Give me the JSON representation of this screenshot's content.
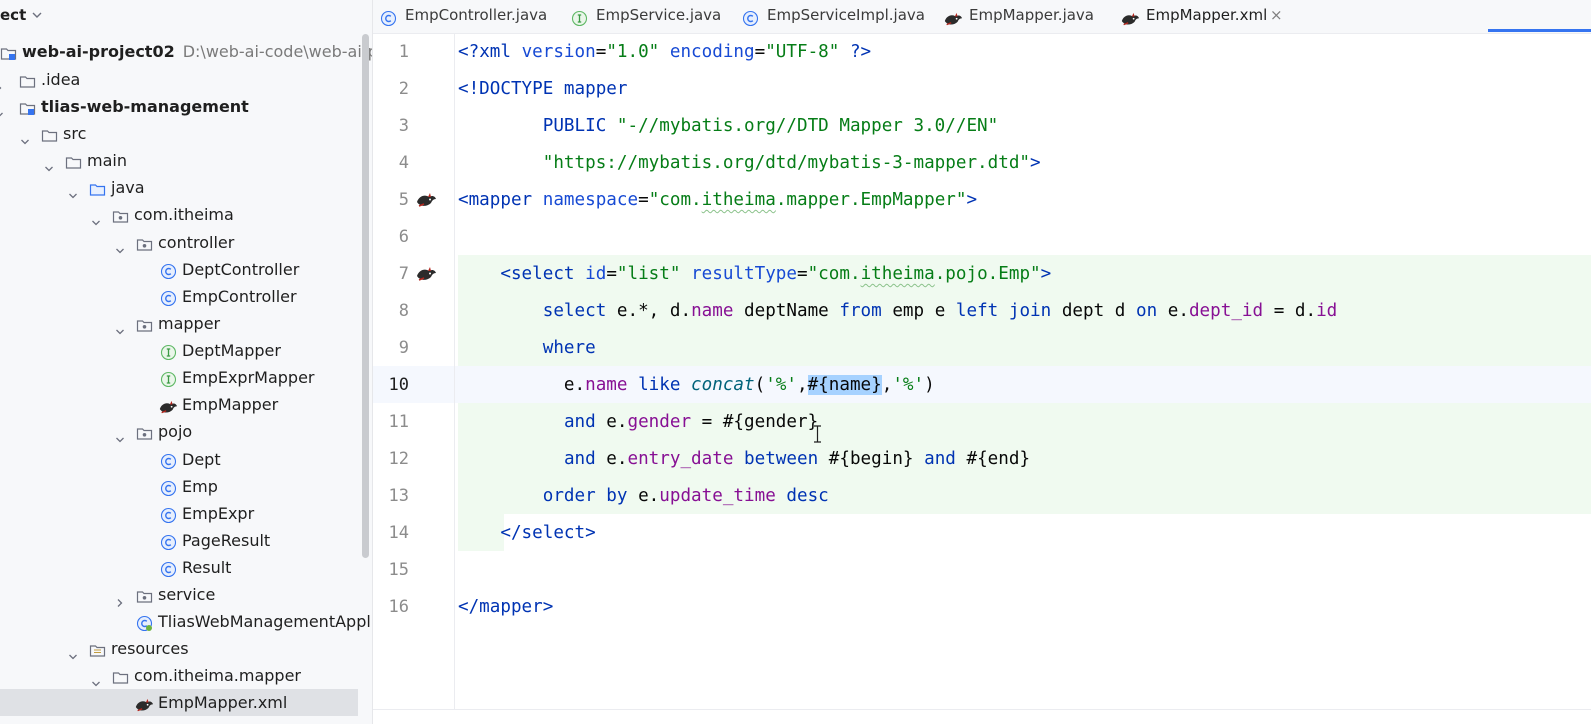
{
  "project_panel": {
    "title": "ect",
    "tree": [
      {
        "label": "web-ai-project02",
        "path": "D:\\web-ai-code\\web-ai-proj",
        "icon": "module-icon",
        "bold": true
      },
      {
        "label": ".idea",
        "icon": "folder-icon"
      },
      {
        "label": "tlias-web-management",
        "icon": "module-icon",
        "bold": true
      },
      {
        "label": "src",
        "icon": "folder-icon"
      },
      {
        "label": "main",
        "icon": "folder-icon"
      },
      {
        "label": "java",
        "icon": "source-folder-icon"
      },
      {
        "label": "com.itheima",
        "icon": "package-icon"
      },
      {
        "label": "controller",
        "icon": "package-icon"
      },
      {
        "label": "DeptController",
        "icon": "class-icon"
      },
      {
        "label": "EmpController",
        "icon": "class-icon"
      },
      {
        "label": "mapper",
        "icon": "package-icon"
      },
      {
        "label": "DeptMapper",
        "icon": "interface-icon"
      },
      {
        "label": "EmpExprMapper",
        "icon": "interface-icon"
      },
      {
        "label": "EmpMapper",
        "icon": "mybatis-icon"
      },
      {
        "label": "pojo",
        "icon": "package-icon"
      },
      {
        "label": "Dept",
        "icon": "class-icon"
      },
      {
        "label": "Emp",
        "icon": "class-icon"
      },
      {
        "label": "EmpExpr",
        "icon": "class-icon"
      },
      {
        "label": "PageResult",
        "icon": "class-icon"
      },
      {
        "label": "Result",
        "icon": "class-icon"
      },
      {
        "label": "service",
        "icon": "package-icon"
      },
      {
        "label": "TliasWebManagementApplic",
        "icon": "spring-app-icon"
      },
      {
        "label": "resources",
        "icon": "resources-folder-icon"
      },
      {
        "label": "com.itheima.mapper",
        "icon": "folder-icon"
      },
      {
        "label": "EmpMapper.xml",
        "icon": "mybatis-icon",
        "selected": true
      }
    ]
  },
  "tabs": [
    {
      "label": "EmpController.java",
      "icon": "class-icon"
    },
    {
      "label": "EmpService.java",
      "icon": "interface-icon"
    },
    {
      "label": "EmpServiceImpl.java",
      "icon": "class-icon"
    },
    {
      "label": "EmpMapper.java",
      "icon": "mybatis-icon"
    },
    {
      "label": "EmpMapper.xml",
      "icon": "mybatis-icon",
      "active": true
    }
  ],
  "tab_close": "×",
  "editor": {
    "current_line": "10",
    "line_numbers": [
      "1",
      "2",
      "3",
      "4",
      "5",
      "6",
      "7",
      "8",
      "9",
      "10",
      "11",
      "12",
      "13",
      "14",
      "15",
      "16"
    ],
    "lines": [
      {
        "n": "1",
        "segs": [
          [
            "pi",
            "<?"
          ],
          [
            "tag",
            "xml "
          ],
          [
            "attr",
            "version"
          ],
          [
            "plain",
            "="
          ],
          [
            "str",
            "\"1.0\""
          ],
          [
            "plain",
            " "
          ],
          [
            "attr",
            "encoding"
          ],
          [
            "plain",
            "="
          ],
          [
            "str",
            "\"UTF-8\""
          ],
          [
            "plain",
            " "
          ],
          [
            "pi",
            "?>"
          ]
        ]
      },
      {
        "n": "2",
        "segs": [
          [
            "tag",
            "<!DOCTYPE mapper"
          ]
        ]
      },
      {
        "n": "3",
        "segs": [
          [
            "plain",
            "        "
          ],
          [
            "tag",
            "PUBLIC "
          ],
          [
            "str",
            "\"-//mybatis.org//DTD Mapper 3.0//EN\""
          ]
        ]
      },
      {
        "n": "4",
        "segs": [
          [
            "plain",
            "        "
          ],
          [
            "str",
            "\"https://mybatis.org/dtd/mybatis-3-mapper.dtd\""
          ],
          [
            "tag",
            ">"
          ]
        ]
      },
      {
        "n": "5",
        "segs": [
          [
            "tag",
            "<mapper "
          ],
          [
            "attr",
            "namespace"
          ],
          [
            "plain",
            "="
          ],
          [
            "str",
            "\"com."
          ],
          [
            "strw",
            "itheima"
          ],
          [
            "str",
            ".mapper.EmpMapper\""
          ],
          [
            "tag",
            ">"
          ]
        ]
      },
      {
        "n": "6",
        "segs": []
      },
      {
        "n": "7",
        "segs": [
          [
            "plain",
            "    "
          ],
          [
            "tag",
            "<select "
          ],
          [
            "attr",
            "id"
          ],
          [
            "plain",
            "="
          ],
          [
            "str",
            "\"list\""
          ],
          [
            "plain",
            " "
          ],
          [
            "attr",
            "resultType"
          ],
          [
            "plain",
            "="
          ],
          [
            "str",
            "\"com."
          ],
          [
            "strw",
            "itheima"
          ],
          [
            "str",
            ".pojo.Emp\""
          ],
          [
            "tag",
            ">"
          ]
        ]
      },
      {
        "n": "8",
        "segs": [
          [
            "plain",
            "        "
          ],
          [
            "kw",
            "select"
          ],
          [
            "plain",
            " e.*, d."
          ],
          [
            "fld",
            "name"
          ],
          [
            "plain",
            " deptName "
          ],
          [
            "kw",
            "from"
          ],
          [
            "plain",
            " emp e "
          ],
          [
            "kw",
            "left join"
          ],
          [
            "plain",
            " dept d "
          ],
          [
            "kw",
            "on"
          ],
          [
            "plain",
            " e."
          ],
          [
            "fld",
            "dept_id"
          ],
          [
            "plain",
            " = d."
          ],
          [
            "fld",
            "id"
          ]
        ]
      },
      {
        "n": "9",
        "segs": [
          [
            "plain",
            "        "
          ],
          [
            "kw",
            "where"
          ]
        ]
      },
      {
        "n": "10",
        "segs": [
          [
            "plain",
            "          e."
          ],
          [
            "fld",
            "name"
          ],
          [
            "plain",
            " "
          ],
          [
            "kw",
            "like"
          ],
          [
            "plain",
            " "
          ],
          [
            "fn",
            "concat"
          ],
          [
            "plain",
            "("
          ],
          [
            "str",
            "'%'"
          ],
          [
            "plain",
            ","
          ],
          [
            "sel",
            "#{name}"
          ],
          [
            "plain",
            ","
          ],
          [
            "str",
            "'%'"
          ],
          [
            "plain",
            ")"
          ]
        ]
      },
      {
        "n": "11",
        "segs": [
          [
            "plain",
            "          "
          ],
          [
            "kw",
            "and"
          ],
          [
            "plain",
            " e."
          ],
          [
            "fld",
            "gender"
          ],
          [
            "plain",
            " = #{gender}"
          ]
        ]
      },
      {
        "n": "12",
        "segs": [
          [
            "plain",
            "          "
          ],
          [
            "kw",
            "and"
          ],
          [
            "plain",
            " e."
          ],
          [
            "fld",
            "entry_date"
          ],
          [
            "plain",
            " "
          ],
          [
            "kw",
            "between"
          ],
          [
            "plain",
            " #{begin} "
          ],
          [
            "kw",
            "and"
          ],
          [
            "plain",
            " #{end}"
          ]
        ]
      },
      {
        "n": "13",
        "segs": [
          [
            "plain",
            "        "
          ],
          [
            "kw",
            "order by"
          ],
          [
            "plain",
            " e."
          ],
          [
            "fld",
            "update_time"
          ],
          [
            "plain",
            " "
          ],
          [
            "kw",
            "desc"
          ]
        ]
      },
      {
        "n": "14",
        "segs": [
          [
            "plain",
            "    "
          ],
          [
            "tag",
            "</select>"
          ]
        ]
      },
      {
        "n": "15",
        "segs": []
      },
      {
        "n": "16",
        "segs": [
          [
            "tag",
            "</mapper>"
          ]
        ]
      }
    ],
    "gutter_icons": [
      {
        "line": "5",
        "icon": "mybatis-navigate-icon"
      },
      {
        "line": "7",
        "icon": "mybatis-navigate-icon"
      }
    ]
  },
  "colors": {
    "tag": "#0033b3",
    "string": "#067d17",
    "field": "#871094",
    "function": "#00627a",
    "selection": "#a6d2ff",
    "accent": "#3574f0"
  }
}
